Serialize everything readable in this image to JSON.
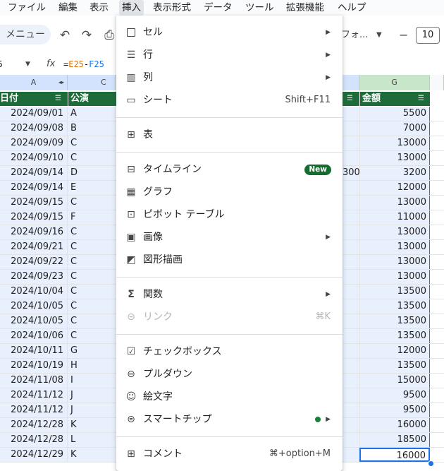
{
  "menubar": {
    "items": [
      "ファイル",
      "編集",
      "表示",
      "挿入",
      "表示形式",
      "データ",
      "ツール",
      "拡張機能",
      "ヘルプ"
    ],
    "active": "挿入"
  },
  "toolbar": {
    "menu_search": "メニュー",
    "font": "フォ...",
    "font_size": "10"
  },
  "formula_bar": {
    "name_box": "5",
    "fx": "fx",
    "formula_eq": "=",
    "formula_ref1": "E25",
    "formula_op": "-",
    "formula_ref2": "F25"
  },
  "columns": [
    "A",
    "C",
    "G"
  ],
  "header_row": {
    "col_a": "日付",
    "col_b": "公演",
    "col_g": "金額"
  },
  "rows": [
    {
      "date": "2024/09/01",
      "perf": "A",
      "f": "",
      "amount": "5500"
    },
    {
      "date": "2024/09/08",
      "perf": "B",
      "f": "",
      "amount": "7000"
    },
    {
      "date": "2024/09/09",
      "perf": "C",
      "f": "",
      "amount": "13000"
    },
    {
      "date": "2024/09/10",
      "perf": "C",
      "f": "",
      "amount": "13000"
    },
    {
      "date": "2024/09/14",
      "perf": "D",
      "f": "300",
      "amount": "3200"
    },
    {
      "date": "2024/09/14",
      "perf": "E",
      "f": "",
      "amount": "12000"
    },
    {
      "date": "2024/09/15",
      "perf": "C",
      "f": "",
      "amount": "13000"
    },
    {
      "date": "2024/09/15",
      "perf": "F",
      "f": "",
      "amount": "11000"
    },
    {
      "date": "2024/09/16",
      "perf": "C",
      "f": "",
      "amount": "13000"
    },
    {
      "date": "2024/09/21",
      "perf": "C",
      "f": "",
      "amount": "13000"
    },
    {
      "date": "2024/09/22",
      "perf": "C",
      "f": "",
      "amount": "13000"
    },
    {
      "date": "2024/09/23",
      "perf": "C",
      "f": "",
      "amount": "13000"
    },
    {
      "date": "2024/10/04",
      "perf": "C",
      "f": "",
      "amount": "13500"
    },
    {
      "date": "2024/10/05",
      "perf": "C",
      "f": "",
      "amount": "13500"
    },
    {
      "date": "2024/10/05",
      "perf": "C",
      "f": "",
      "amount": "13500"
    },
    {
      "date": "2024/10/06",
      "perf": "C",
      "f": "",
      "amount": "13500"
    },
    {
      "date": "2024/10/11",
      "perf": "G",
      "f": "",
      "amount": "12000"
    },
    {
      "date": "2024/10/19",
      "perf": "H",
      "f": "",
      "amount": "13500"
    },
    {
      "date": "2024/11/08",
      "perf": "I",
      "f": "",
      "amount": "15000"
    },
    {
      "date": "2024/11/12",
      "perf": "J",
      "f": "",
      "amount": "9500"
    },
    {
      "date": "2024/11/12",
      "perf": "J",
      "f": "",
      "amount": "9500"
    },
    {
      "date": "2024/12/28",
      "perf": "K",
      "f": "",
      "amount": "16000"
    },
    {
      "date": "2024/12/28",
      "perf": "L",
      "f": "",
      "amount": "18500"
    },
    {
      "date": "2024/12/29",
      "perf": "K",
      "f": "",
      "amount": "16000"
    }
  ],
  "insert_menu": {
    "cells": "セル",
    "rows": "行",
    "columns": "列",
    "sheet": "シート",
    "sheet_shortcut": "Shift+F11",
    "table": "表",
    "timeline": "タイムライン",
    "timeline_badge": "New",
    "chart": "グラフ",
    "pivot": "ピボット テーブル",
    "image": "画像",
    "drawing": "図形描画",
    "function": "関数",
    "link": "リンク",
    "link_shortcut": "⌘K",
    "checkbox": "チェックボックス",
    "dropdown": "プルダウン",
    "emoji": "絵文字",
    "smart_chips": "スマートチップ",
    "comment": "コメント",
    "comment_shortcut": "⌘+option+M"
  },
  "colors": {
    "header_green": "#1e6b3a",
    "selection_blue": "#1a73e8",
    "badge_green": "#146c2e"
  }
}
